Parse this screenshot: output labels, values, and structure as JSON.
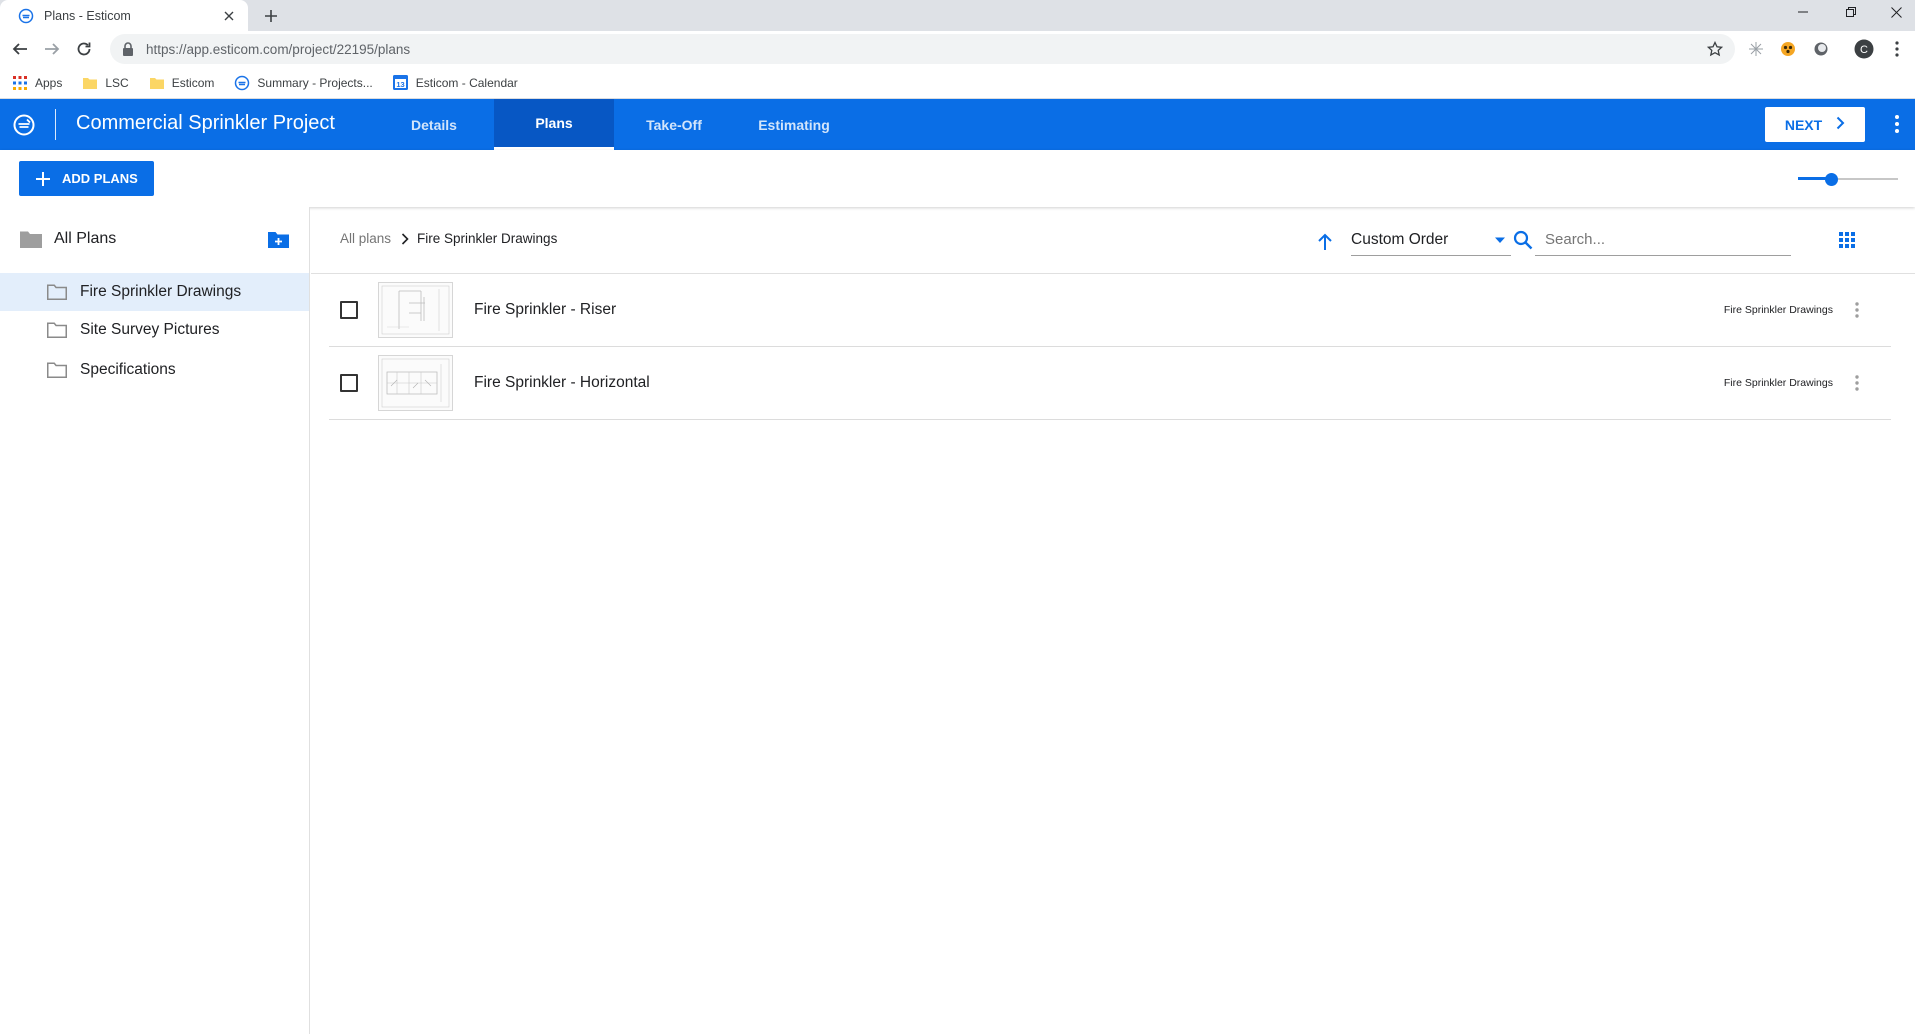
{
  "browser": {
    "tab_title": "Plans - Esticom",
    "url": "https://app.esticom.com/project/22195/plans",
    "profile_initial": "C",
    "bookmarks": [
      {
        "label": "Apps",
        "icon": "apps-grid-icon"
      },
      {
        "label": "LSC",
        "icon": "folder-icon"
      },
      {
        "label": "Esticom",
        "icon": "folder-icon"
      },
      {
        "label": "Summary - Projects...",
        "icon": "esticom-logo-icon"
      },
      {
        "label": "Esticom - Calendar",
        "icon": "calendar-icon",
        "badge": "13"
      }
    ]
  },
  "header": {
    "project_title": "Commercial Sprinkler Project",
    "tabs": [
      {
        "label": "Details",
        "active": false
      },
      {
        "label": "Plans",
        "active": true
      },
      {
        "label": "Take-Off",
        "active": false
      },
      {
        "label": "Estimating",
        "active": false
      }
    ],
    "next_label": "NEXT"
  },
  "actions": {
    "add_plans_label": "ADD PLANS",
    "zoom_level": 0.33
  },
  "sidebar": {
    "root_label": "All Plans",
    "folders": [
      {
        "label": "Fire Sprinkler Drawings",
        "selected": true
      },
      {
        "label": "Site Survey Pictures",
        "selected": false
      },
      {
        "label": "Specifications",
        "selected": false
      }
    ]
  },
  "main": {
    "breadcrumb": {
      "root": "All plans",
      "current": "Fire Sprinkler Drawings"
    },
    "sort": {
      "value": "Custom Order"
    },
    "search": {
      "placeholder": "Search..."
    },
    "plans": [
      {
        "name": "Fire Sprinkler - Riser",
        "folder": "Fire Sprinkler Drawings",
        "checked": false
      },
      {
        "name": "Fire Sprinkler - Horizontal",
        "folder": "Fire Sprinkler Drawings",
        "checked": false
      }
    ]
  },
  "colors": {
    "brand": "#0a6ee6",
    "brand_dark": "#0757c4",
    "selected_row": "#e3eefb"
  }
}
